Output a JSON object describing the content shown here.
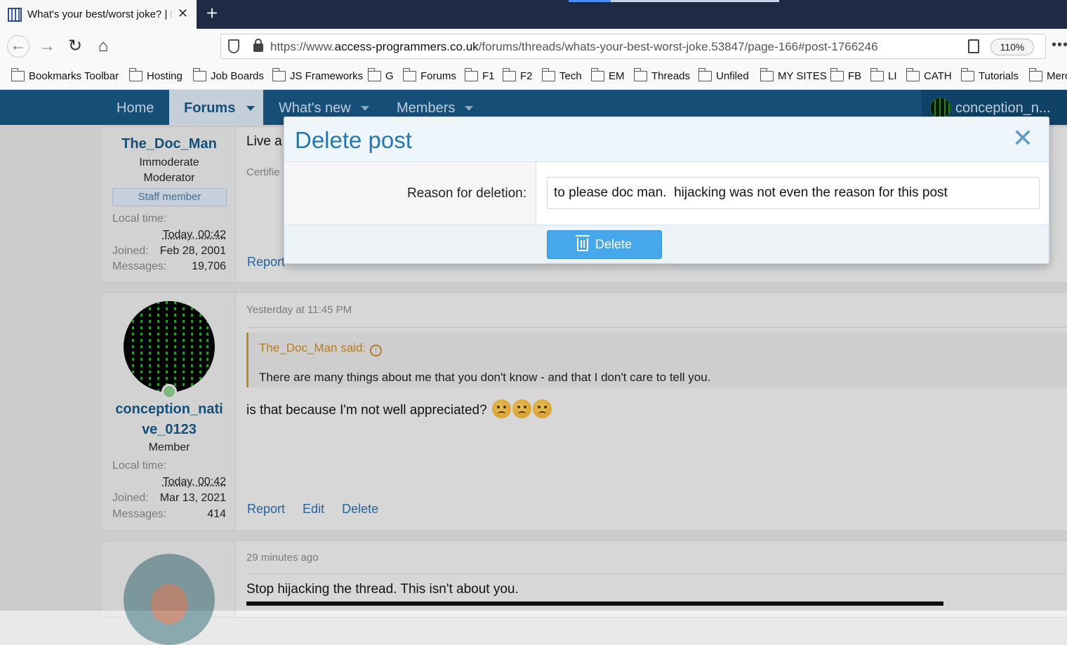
{
  "browser": {
    "tab_title": "What's your best/worst joke? | F",
    "url_prefix": "https://www.",
    "url_domain": "access-programmers.co.uk",
    "url_path": "/forums/threads/whats-your-best-worst-joke.53847/page-166#post-1766246",
    "zoom": "110%",
    "bookmarks": [
      "Bookmarks Toolbar",
      "Hosting",
      "Job Boards",
      "JS Frameworks",
      "G",
      "Forums",
      "F1",
      "F2",
      "Tech",
      "EM",
      "Threads",
      "Unfiled",
      "MY SITES",
      "FB",
      "LI",
      "CATH",
      "Tutorials",
      "Merc"
    ]
  },
  "forum_nav": {
    "home": "Home",
    "forums": "Forums",
    "whats_new": "What's new",
    "members": "Members",
    "user": "conception_n..."
  },
  "posts": [
    {
      "username": "The_Doc_Man",
      "title_line1": "Immoderate",
      "title_line2": "Moderator",
      "badge": "Staff member",
      "local_time_label": "Local time:",
      "local_time": "Today, 00:42",
      "joined_label": "Joined:",
      "joined": "Feb 28, 2001",
      "messages_label": "Messages:",
      "messages": "19,706",
      "text_partial": "Live a",
      "sig_partial": "Certifie",
      "action": "Report"
    },
    {
      "username_line1": "conception_nati",
      "username_line2": "ve_0123",
      "role": "Member",
      "local_time_label": "Local time:",
      "local_time": "Today, 00:42",
      "joined_label": "Joined:",
      "joined": "Mar 13, 2021",
      "messages_label": "Messages:",
      "messages": "414",
      "time": "Yesterday at 11:45 PM",
      "quote_author": "The_Doc_Man said:",
      "quote_text": "There are many things about me that you don't know - and that I don't care to tell you.",
      "text": "is that because I'm not well appreciated?",
      "actions": [
        "Report",
        "Edit",
        "Delete"
      ]
    },
    {
      "time": "29 minutes ago",
      "text": "Stop hijacking the thread. This isn't about you."
    }
  ],
  "modal": {
    "title": "Delete post",
    "reason_label": "Reason for deletion:",
    "reason_value": "to please doc man.  hijacking was not even the reason for this post",
    "delete_label": "Delete"
  }
}
